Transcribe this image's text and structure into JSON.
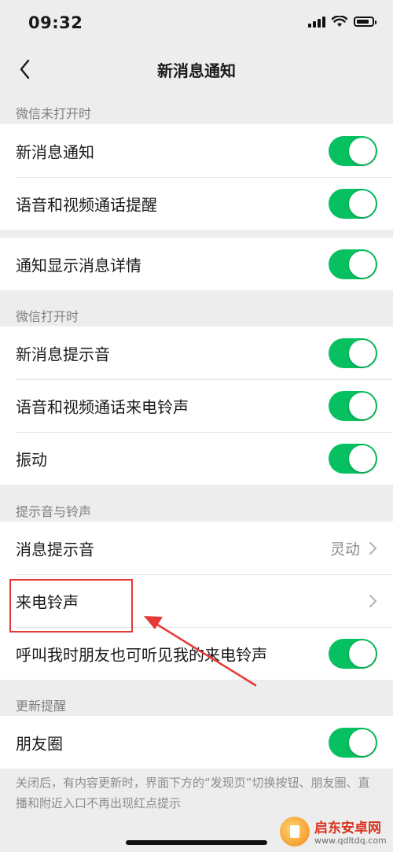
{
  "status_bar": {
    "time": "09:32"
  },
  "nav": {
    "title": "新消息通知",
    "back_icon": "chevron-left-icon"
  },
  "sections": {
    "wechat_closed": {
      "header": "微信未打开时",
      "new_message_label": "新消息通知",
      "new_message_on": true,
      "call_reminder_label": "语音和视频通话提醒",
      "call_reminder_on": true
    },
    "detail": {
      "show_details_label": "通知显示消息详情",
      "show_details_on": true
    },
    "wechat_open": {
      "header": "微信打开时",
      "sound_label": "新消息提示音",
      "sound_on": true,
      "ringtone_label": "语音和视频通话来电铃声",
      "ringtone_on": true,
      "vibrate_label": "振动",
      "vibrate_on": true
    },
    "sounds": {
      "header": "提示音与铃声",
      "message_sound_label": "消息提示音",
      "message_sound_value": "灵动",
      "call_ringtone_label": "来电铃声",
      "friends_hear_label": "呼叫我时朋友也可听见我的来电铃声",
      "friends_hear_on": true
    },
    "updates": {
      "header": "更新提醒",
      "moments_label": "朋友圈",
      "moments_on": true
    }
  },
  "footer_note": "关闭后，有内容更新时，界面下方的“发现页”切换按钮、朋友圈、直播和附近入口不再出现红点提示",
  "colors": {
    "toggle_on": "#07c160",
    "annotation": "#e53935",
    "background": "#ededed"
  },
  "watermark": {
    "name": "启东安卓网",
    "url": "www.qdltdq.com"
  }
}
